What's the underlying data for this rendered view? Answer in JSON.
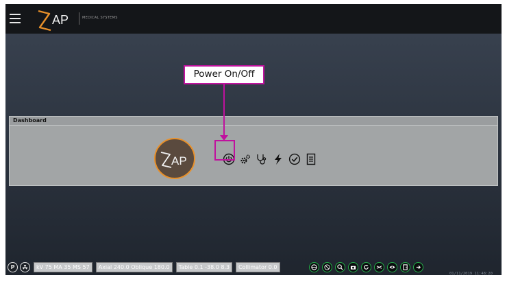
{
  "header": {
    "brand": "AP",
    "brand_sub": "MEDICAL SYSTEMS"
  },
  "dashboard": {
    "title": "Dashboard",
    "emblem_text": "AP",
    "tools": [
      {
        "name": "power-icon"
      },
      {
        "name": "gears-icon"
      },
      {
        "name": "stethoscope-icon"
      },
      {
        "name": "lightning-icon"
      },
      {
        "name": "check-circle-icon"
      },
      {
        "name": "document-icon"
      }
    ]
  },
  "callout": {
    "label": "Power On/Off"
  },
  "status": {
    "p_label": "P",
    "beam": "kV 75  MA 35  MS 57",
    "angles": "Axial 240.0  Oblique 180.0",
    "table": "Table  0.1   -38.0   8.3",
    "collimator": "Collimator  0.0",
    "timestamp": "01/11/2019 11:48:20"
  },
  "colors": {
    "accent_orange": "#e8902a",
    "callout_magenta": "#c0119e",
    "status_green": "#24b04a"
  }
}
